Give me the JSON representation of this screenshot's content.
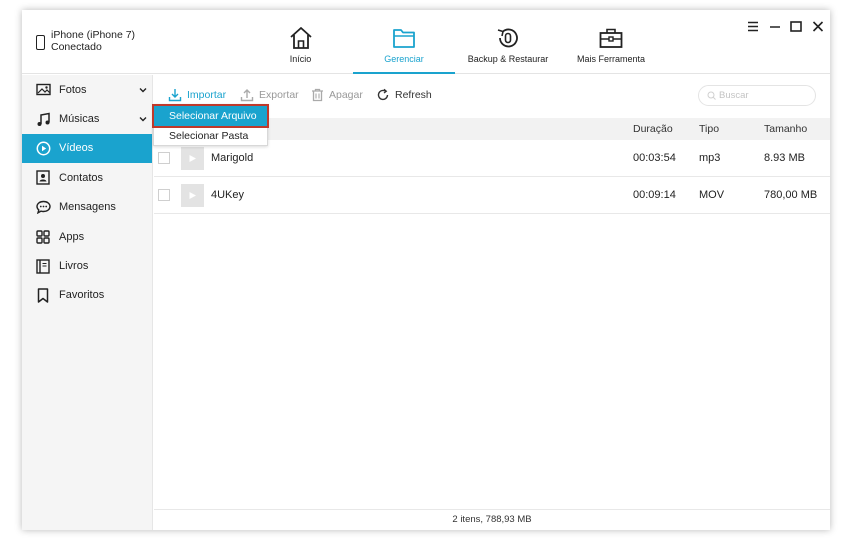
{
  "device": {
    "name": "iPhone (iPhone 7)",
    "status": "Conectado"
  },
  "nav": [
    {
      "label": "Início",
      "icon": "home-icon"
    },
    {
      "label": "Gerenciar",
      "icon": "folder-icon",
      "active": true
    },
    {
      "label": "Backup & Restaurar",
      "icon": "backup-restore-icon"
    },
    {
      "label": "Mais Ferramenta",
      "icon": "toolbox-icon"
    }
  ],
  "window_controls": [
    "menu-icon",
    "minimize-icon",
    "maximize-icon",
    "close-icon"
  ],
  "sidebar": {
    "items": [
      {
        "label": "Fotos",
        "icon": "photo-icon",
        "expandable": true
      },
      {
        "label": "Músicas",
        "icon": "music-icon",
        "expandable": true
      },
      {
        "label": "Vídeos",
        "icon": "video-icon",
        "active": true
      },
      {
        "label": "Contatos",
        "icon": "contact-icon"
      },
      {
        "label": "Mensagens",
        "icon": "message-icon"
      },
      {
        "label": "Apps",
        "icon": "apps-icon"
      },
      {
        "label": "Livros",
        "icon": "book-icon"
      },
      {
        "label": "Favoritos",
        "icon": "bookmark-icon"
      }
    ]
  },
  "toolbar": {
    "import_label": "Importar",
    "export_label": "Exportar",
    "delete_label": "Apagar",
    "refresh_label": "Refresh",
    "search_placeholder": "Buscar"
  },
  "dropdown": {
    "items": [
      "Selecionar Arquivo",
      "Selecionar Pasta"
    ]
  },
  "table": {
    "columns": [
      "Duração",
      "Tipo",
      "Tamanho"
    ],
    "rows": [
      {
        "name": "Marigold",
        "duration": "00:03:54",
        "type": "mp3",
        "size": "8.93 MB"
      },
      {
        "name": "4UKey",
        "duration": "00:09:14",
        "type": "MOV",
        "size": "780,00 MB"
      }
    ]
  },
  "status_text": "2 itens, 788,93 MB",
  "colors": {
    "accent": "#1aa3ce",
    "highlight_border": "#c0392b"
  }
}
